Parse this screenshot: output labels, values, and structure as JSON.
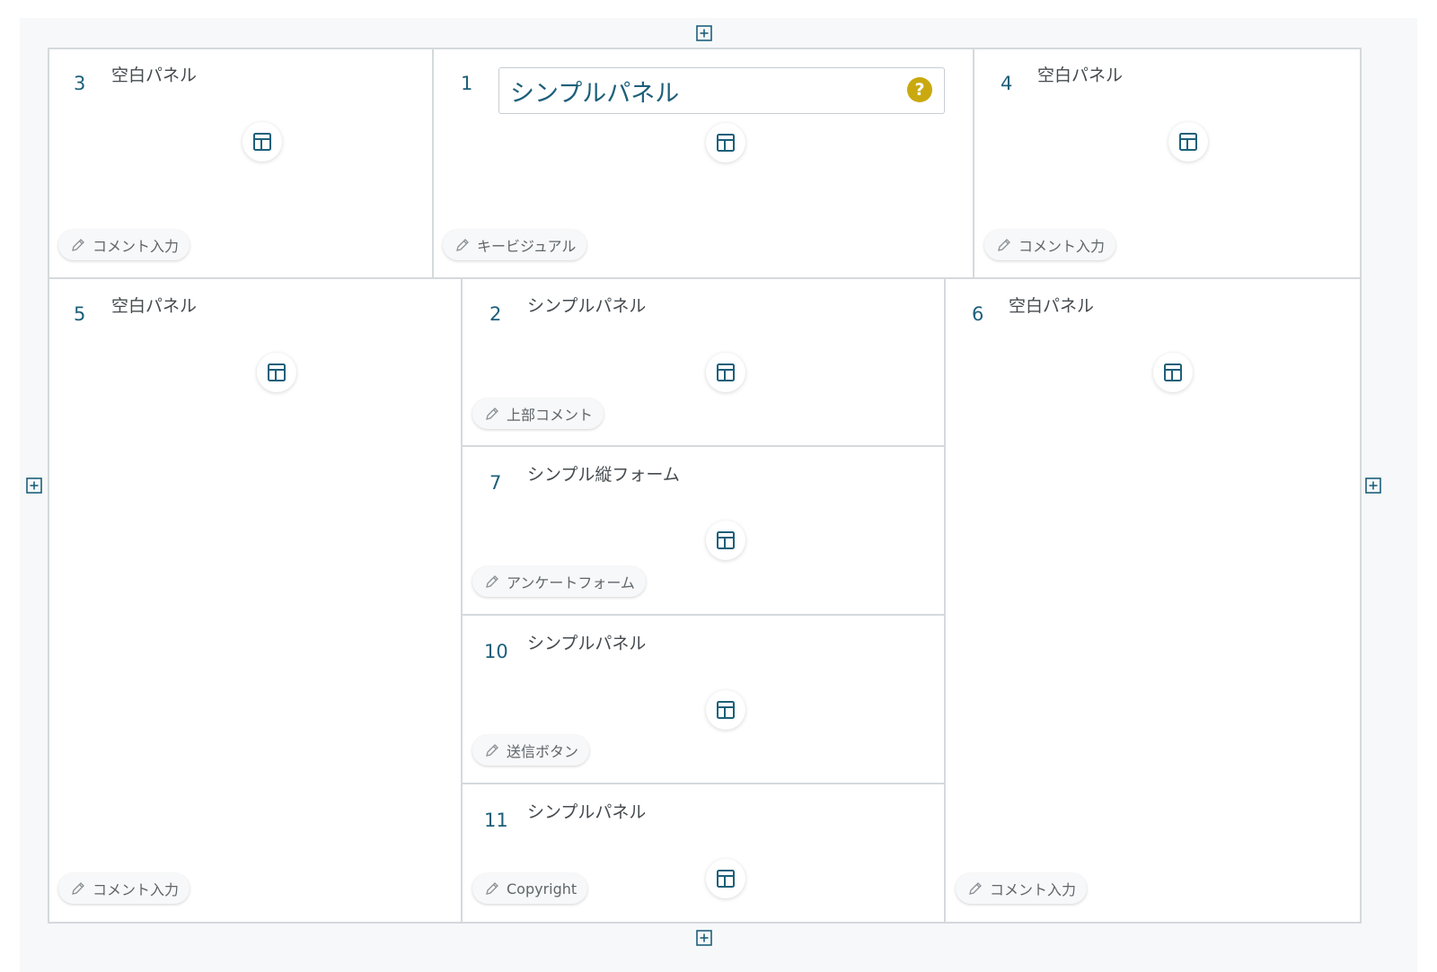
{
  "panels": [
    {
      "num": "3",
      "title": "空白パネル",
      "comment": "コメント入力"
    },
    {
      "num": "1",
      "title": "シンプルパネル",
      "comment": "キービジュアル"
    },
    {
      "num": "4",
      "title": "空白パネル",
      "comment": "コメント入力"
    },
    {
      "num": "5",
      "title": "空白パネル",
      "comment": "コメント入力"
    },
    {
      "num": "2",
      "title": "シンプルパネル",
      "comment": "上部コメント"
    },
    {
      "num": "7",
      "title": "シンプル縦フォーム",
      "comment": "アンケートフォーム"
    },
    {
      "num": "10",
      "title": "シンプルパネル",
      "comment": "送信ボタン"
    },
    {
      "num": "11",
      "title": "シンプルパネル",
      "comment": "Copyright"
    },
    {
      "num": "6",
      "title": "空白パネル",
      "comment": "コメント入力"
    }
  ],
  "help_label": "?",
  "icons": {
    "add": "plus-square-icon",
    "layout": "layout-template-icon",
    "comment": "pencil-icon",
    "help": "question-circle-icon"
  },
  "colors": {
    "accent": "#1d5f7a",
    "help": "#c9a90f",
    "border": "#d5d9dc",
    "canvas": "#f6f8f9"
  }
}
